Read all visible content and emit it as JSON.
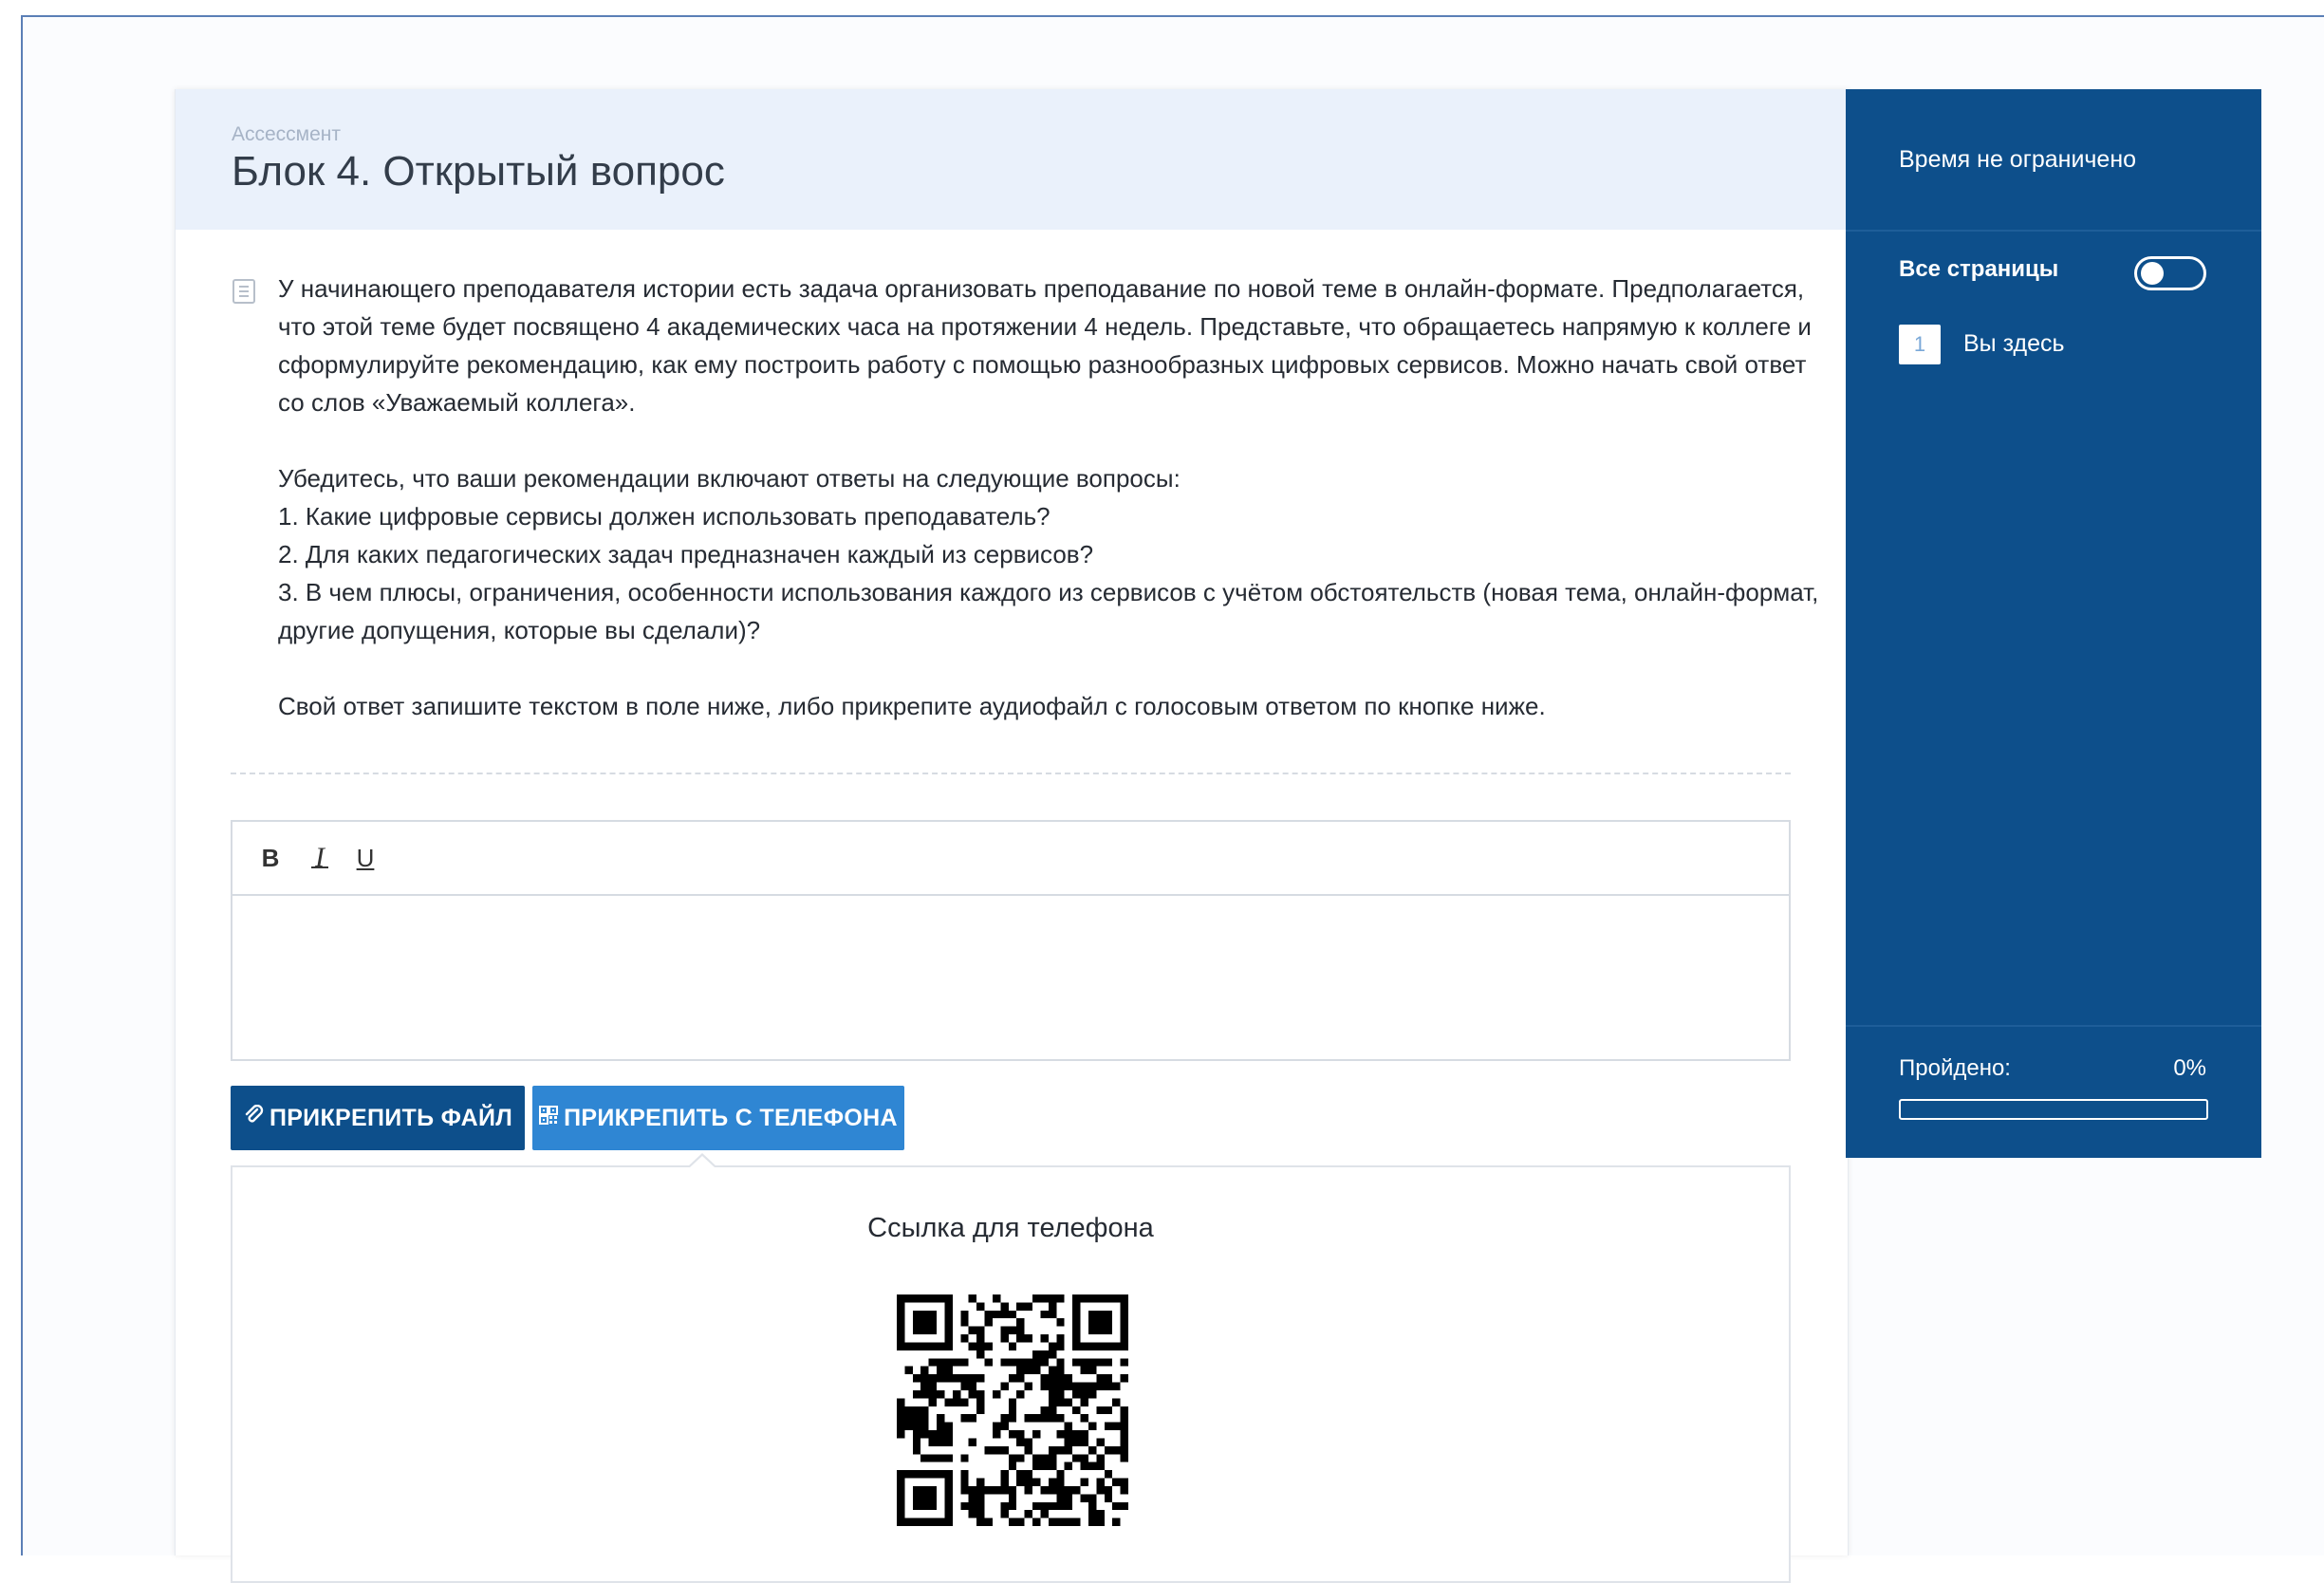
{
  "header": {
    "breadcrumb": "Ассессмент",
    "title": "Блок 4. Открытый вопрос"
  },
  "question": {
    "paragraph1": "У начинающего преподавателя истории есть задача организовать преподавание по новой теме в онлайн-формате. Предполагается, что этой теме будет посвящено 4 академических часа на протяжении 4 недель. Представьте, что обращаетесь напрямую к коллеге и сформулируйте рекомендацию, как ему построить работу с помощью разнообразных цифровых сервисов. Можно начать свой ответ со слов «Уважаемый коллега».",
    "paragraph2": "Убедитесь, что ваши рекомендации включают ответы на следующие вопросы:\n1. Какие цифровые сервисы должен использовать преподаватель?\n2. Для каких педагогических задач предназначен каждый из сервисов?\n3. В чем плюсы, ограничения, особенности использования каждого из сервисов с учётом обстоятельств (новая тема, онлайн-формат, другие допущения, которые вы сделали)?",
    "paragraph3": "Свой ответ запишите текстом в поле ниже, либо прикрепите аудиофайл с голосовым ответом по кнопке ниже."
  },
  "editor": {
    "bold": "B",
    "italic": "I",
    "underline": "U",
    "value": ""
  },
  "buttons": {
    "attach_file": "ПРИКРЕПИТЬ ФАЙЛ",
    "attach_phone": "ПРИКРЕПИТЬ С ТЕЛЕФОНА",
    "attach_file_icon": "paperclip-icon",
    "attach_phone_icon": "qrcode-icon"
  },
  "phone_panel": {
    "title": "Ссылка для телефона"
  },
  "sidebar": {
    "time": "Время не ограничено",
    "all_pages": "Все страницы",
    "all_pages_toggle": false,
    "page_number": "1",
    "you_are_here": "Вы здесь",
    "passed_label": "Пройдено:",
    "passed_value": "0%",
    "progress": 0
  },
  "colors": {
    "sidebar_bg": "#0d4f8b",
    "btn_primary": "#0d4f8b",
    "btn_secondary": "#2f86d3",
    "header_bg": "#eaf1fb"
  }
}
